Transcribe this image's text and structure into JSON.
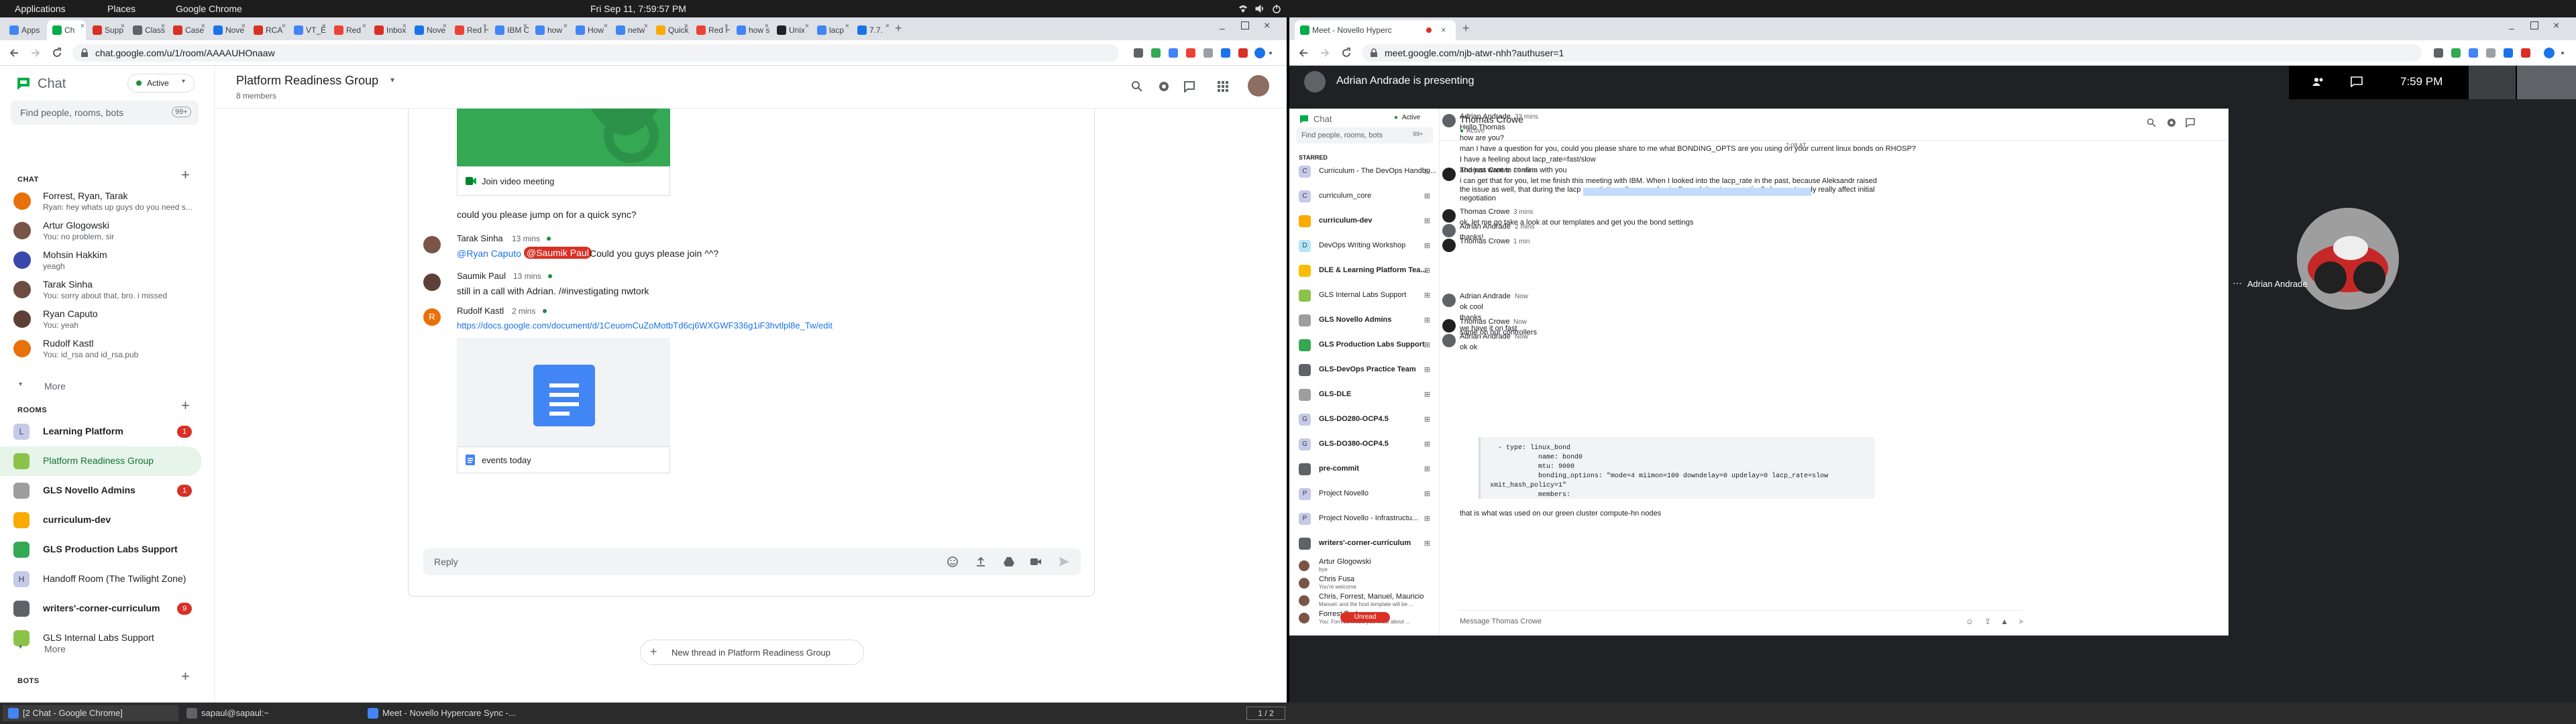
{
  "topbar": {
    "applications": "Applications",
    "places": "Places",
    "chrome": "Google Chrome",
    "clock": "Fri Sep 11,  7:59:57 PM"
  },
  "left_browser": {
    "tabs": [
      {
        "label": "Apps"
      },
      {
        "label": "Ch"
      },
      {
        "label": "Supp"
      },
      {
        "label": "Class"
      },
      {
        "label": "Case"
      },
      {
        "label": "Nove"
      },
      {
        "label": "RCA"
      },
      {
        "label": "VT_E"
      },
      {
        "label": "Red"
      },
      {
        "label": "Inbox"
      },
      {
        "label": "Nove"
      },
      {
        "label": "Red H"
      },
      {
        "label": "IBM C"
      },
      {
        "label": "how"
      },
      {
        "label": "How"
      },
      {
        "label": "netw"
      },
      {
        "label": "Quick"
      },
      {
        "label": "Red H"
      },
      {
        "label": "how s"
      },
      {
        "label": "Unix"
      },
      {
        "label": "lacp"
      },
      {
        "label": "7.7."
      }
    ],
    "url": "chat.google.com/u/1/room/AAAAUHOnaaw"
  },
  "left_app": {
    "brand": "Chat",
    "status": "Active",
    "search_placeholder": "Find people, rooms, bots",
    "search_badge": "99+",
    "chat_section": "CHAT",
    "dms": [
      {
        "name": "Forrest, Ryan, Tarak",
        "preview": "Ryan: hey whats up guys do you need s..."
      },
      {
        "name": "Artur Glogowski",
        "preview": "You: no problem, sir"
      },
      {
        "name": "Mohsin Hakkim",
        "preview": "yeagh"
      },
      {
        "name": "Tarak Sinha",
        "preview": "You: sorry about that, bro. i missed"
      },
      {
        "name": "Ryan Caputo",
        "preview": "You: yeah"
      },
      {
        "name": "Rudolf Kastl",
        "preview": "You: id_rsa and id_rsa.pub"
      }
    ],
    "more1": "More",
    "rooms_section": "ROOMS",
    "rooms": [
      {
        "name": "Learning Platform",
        "badge": "1",
        "letter": "L"
      },
      {
        "name": "Platform Readiness Group",
        "badge": "",
        "letter": ""
      },
      {
        "name": "GLS Novello Admins",
        "badge": "1",
        "letter": ""
      },
      {
        "name": "curriculum-dev",
        "badge": "",
        "letter": ""
      },
      {
        "name": "GLS Production Labs Support",
        "badge": "",
        "letter": ""
      },
      {
        "name": "Handoff Room (The Twilight Zone)",
        "badge": "",
        "letter": "H"
      },
      {
        "name": "writers'-corner-curriculum",
        "badge": "9",
        "letter": ""
      },
      {
        "name": "GLS Internal Labs Support",
        "badge": "",
        "letter": ""
      }
    ],
    "more2": "More",
    "bots_section": "BOTS",
    "room_title": "Platform Readiness Group",
    "room_members": "8 members",
    "join_video": "Join video meeting",
    "messages": [
      {
        "text": "could you please jump on for a quick sync?"
      },
      {
        "name": "Tarak Sinha",
        "time": "13 mins",
        "mention1": "@Ryan Caputo",
        "mention2": "@Saumik Paul",
        "rest": "Could you guys please join ^^?"
      },
      {
        "name": "Saumik Paul",
        "time": "13 mins",
        "text": "still in a call with Adrian. /#investigating nwtork"
      },
      {
        "name": "Rudolf Kastl",
        "time": "2 mins",
        "link": "https://docs.google.com/document/d/1CeuomCuZoMotbTd6cj6WXGWF336g1iF3hvtlpl8e_Tw/edit"
      }
    ],
    "doc_title": "events today",
    "reply_placeholder": "Reply",
    "new_thread": "New thread in Platform Readiness Group"
  },
  "right_browser": {
    "tab": "Meet - Novello Hyperc",
    "url": "meet.google.com/njb-atwr-nhh?authuser=1"
  },
  "meet": {
    "presenter": "Adrian Andrade is presenting",
    "time": "7:59 PM",
    "tile_name": "Adrian Andrade",
    "chat": {
      "brand": "Chat",
      "status": "Active",
      "search_placeholder": "Find people, rooms, bots",
      "search_badge": "99+",
      "starred": "STARRED",
      "items": [
        {
          "label": "Curriculum - The DevOps Handbo...",
          "icon": "C",
          "color": "#c5cae9"
        },
        {
          "label": "curriculum_core",
          "icon": "C",
          "color": "#c5cae9"
        },
        {
          "label": "curriculum-dev",
          "icon": "",
          "color": "#f9ab00"
        },
        {
          "label": "DevOps Writing Workshop",
          "icon": "D",
          "color": "#b3e5fc"
        },
        {
          "label": "DLE & Learning Platform Tea...",
          "icon": "",
          "color": "#fbbc04"
        },
        {
          "label": "GLS Internal Labs Support",
          "icon": "",
          "color": "#8bc34a"
        },
        {
          "label": "GLS Novello Admins",
          "icon": "",
          "color": "#9e9e9e"
        },
        {
          "label": "GLS Production Labs Support",
          "icon": "",
          "color": "#34a853"
        },
        {
          "label": "GLS-DevOps Practice Team",
          "icon": "",
          "color": "#5f6368"
        },
        {
          "label": "GLS-DLE",
          "icon": "",
          "color": "#9e9e9e"
        },
        {
          "label": "GLS-DO280-OCP4.5",
          "icon": "G",
          "color": "#c5cae9"
        },
        {
          "label": "GLS-DO380-OCP4.5",
          "icon": "G",
          "color": "#c5cae9"
        },
        {
          "label": "pre-commit",
          "icon": "",
          "color": "#5f6368"
        },
        {
          "label": "Project Novello",
          "icon": "P",
          "color": "#c5cae9"
        },
        {
          "label": "Project Novello - Infrastructu...",
          "icon": "P",
          "color": "#c5cae9"
        },
        {
          "label": "writers'-corner-curriculum",
          "icon": "",
          "color": "#5f6368"
        }
      ],
      "dms": [
        {
          "name": "Artur Glogowski",
          "sub": "bye"
        },
        {
          "name": "Chris Fusa",
          "sub": "You're welcome"
        },
        {
          "name": "Chris, Forrest, Manuel, Mauricio",
          "sub": "Manuel: and the host template will be ..."
        },
        {
          "name": "Forrest Taylor",
          "sub": "You: Forrest, would you know about ..."
        }
      ],
      "unread": "Unread",
      "conv_title": "Thomas Crowe",
      "conv_status": "Active",
      "date_sep": "7:08 AT",
      "messages": [
        {
          "name": "Adrian Andrade",
          "time": "33 mins",
          "lines": [
            "Hello Thomas",
            "how are you?",
            "man I have a question for you, could you please share to me what BONDING_OPTS are you using on your current linux bonds on RHOSP?",
            "I have a feeling about lacp_rate=fast/slow",
            "and just want to confirm with you"
          ]
        },
        {
          "name": "Thomas Crowe",
          "time": "29 mins",
          "lines": [
            "i can get that for you, let me finish this meeting with IBM.  When I looked into the lacp_rate in the past, because Aleksandr raised",
            "the issue as well, that during the lacp negotiations the peers basically work it out, so practically lacp_rate only really affect initial",
            "negotiation"
          ]
        },
        {
          "name": "Thomas Crowe",
          "time": "3 mins",
          "lines": [
            "ok, let me go take a look at our templates and get you the bond settings"
          ]
        },
        {
          "name": "Adrian Andrade",
          "time": "2 mins",
          "lines": [
            "thanks!"
          ]
        },
        {
          "name": "Thomas Crowe",
          "time": "1 min",
          "lines": []
        },
        {
          "name": "Adrian Andrade",
          "time": "Now",
          "lines": [
            "ok cool",
            "thanks",
            "we have it on fast"
          ]
        },
        {
          "name": "Thomas Crowe",
          "time": "Now",
          "lines": [
            "same on our controllers"
          ]
        },
        {
          "name": "Adrian Andrade",
          "time": "Now",
          "lines": [
            "ok ok"
          ]
        }
      ],
      "code": [
        "  - type: linux_bond",
        "            name: bond0",
        "            mtu: 9000",
        "            bonding_options: \"mode=4 miimon=100 downdelay=0 updelay=0 lacp_rate=slow",
        "xmit_hash_policy=1\"",
        "            members:"
      ],
      "after_code": "that is what was used on our green cluster compute-hn nodes",
      "reply_placeholder": "Message Thomas Crowe"
    }
  },
  "taskbar": {
    "items": [
      "[2 Chat - Google Chrome]",
      "sapaul@sapaul:~",
      "Meet - Novello Hypercare Sync -..."
    ],
    "workspace": "1 / 2"
  }
}
